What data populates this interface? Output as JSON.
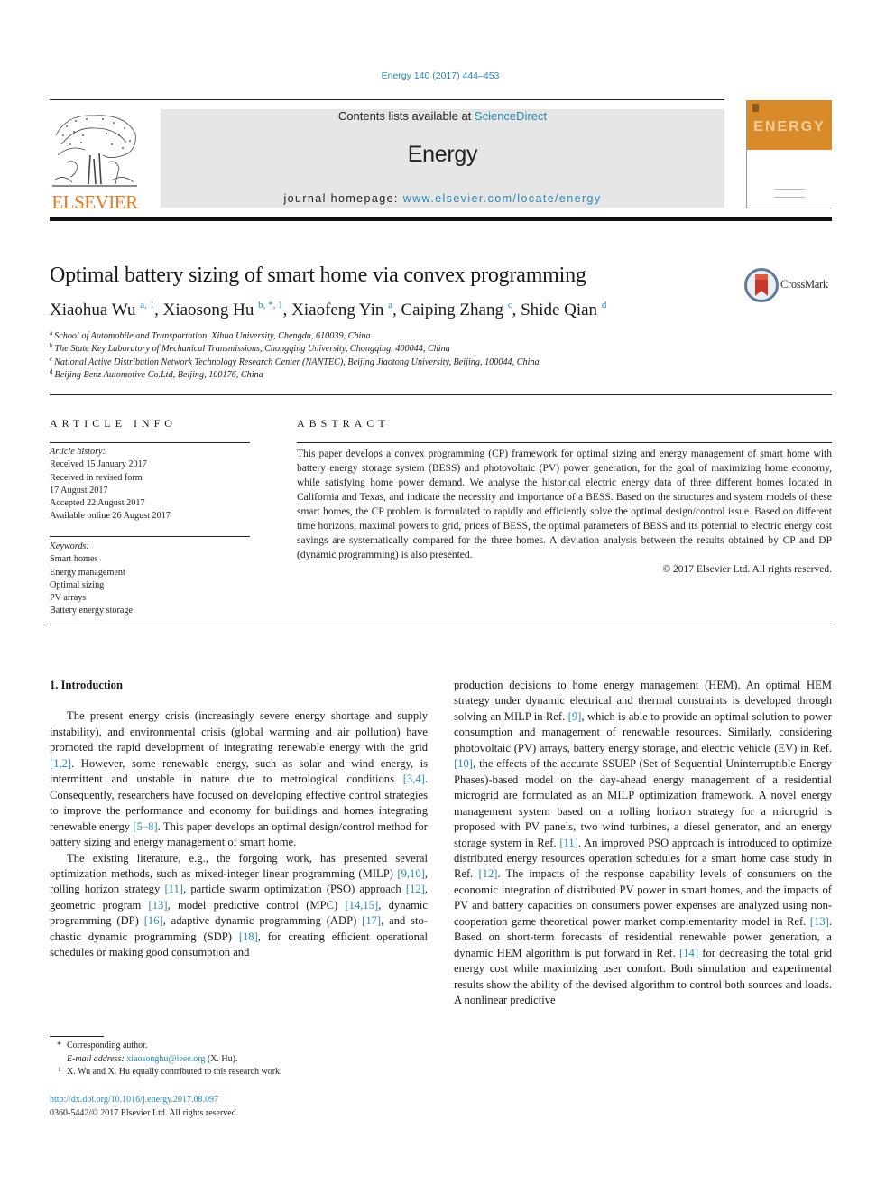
{
  "journal_ref": "Energy 140 (2017) 444–453",
  "publisher": {
    "wordmark": "ELSEVIER",
    "brand_color": "#e87722",
    "link_color": "#2a87b4"
  },
  "masthead": {
    "contents_prefix": "Contents lists available at ",
    "contents_link": "ScienceDirect",
    "journal_name": "Energy",
    "homepage_prefix": "journal homepage: ",
    "homepage_link": "www.elsevier.com/locate/energy"
  },
  "cover": {
    "title": "ENERGY",
    "color": "#d98a2a"
  },
  "article": {
    "title": "Optimal battery sizing of smart home via convex programming",
    "crossmark_label": "CrossMark",
    "authors": [
      {
        "name": "Xiaohua Wu",
        "sup": "a, 1"
      },
      {
        "name": "Xiaosong Hu",
        "sup": "b, *, 1"
      },
      {
        "name": "Xiaofeng Yin",
        "sup": "a"
      },
      {
        "name": "Caiping Zhang",
        "sup": "c"
      },
      {
        "name": "Shide Qian",
        "sup": "d"
      }
    ],
    "affiliations": [
      {
        "mark": "a",
        "text": "School of Automobile and Transportation, Xihua University, Chengdu, 610039, China"
      },
      {
        "mark": "b",
        "text": "The State Key Laboratory of Mechanical Transmissions, Chongqing University, Chongqing, 400044, China"
      },
      {
        "mark": "c",
        "text": "National Active Distribution Network Technology Research Center (NANTEC), Beijing Jiaotong University, Beijing, 100044, China"
      },
      {
        "mark": "d",
        "text": "Beijing Benz Automotive Co.Ltd, Beijing, 100176, China"
      }
    ]
  },
  "article_info": {
    "heading": "ARTICLE INFO",
    "history_label": "Article history:",
    "history": [
      "Received 15 January 2017",
      "Received in revised form",
      "17 August 2017",
      "Accepted 22 August 2017",
      "Available online 26 August 2017"
    ],
    "keywords_label": "Keywords:",
    "keywords": [
      "Smart homes",
      "Energy management",
      "Optimal sizing",
      "PV arrays",
      "Battery energy storage"
    ]
  },
  "abstract": {
    "heading": "ABSTRACT",
    "text": "This paper develops a convex programming (CP) framework for optimal sizing and energy management of smart home with battery energy storage system (BESS) and photovoltaic (PV) power generation, for the goal of maximizing home economy, while satisfying home power demand. We analyse the historical electric energy data of three different homes located in California and Texas, and indicate the necessity and importance of a BESS. Based on the structures and system models of these smart homes, the CP problem is formulated to rapidly and efficiently solve the optimal design/control issue. Based on different time horizons, maximal powers to grid, prices of BESS, the optimal parameters of BESS and its potential to electric energy cost savings are systematically compared for the three homes. A deviation analysis between the results obtained by CP and DP (dynamic programming) is also presented.",
    "copyright": "© 2017 Elsevier Ltd. All rights reserved."
  },
  "body": {
    "section_heading": "1.  Introduction",
    "left_paragraphs": [
      [
        {
          "t": "The present energy crisis (increasingly severe energy shortage and supply instability), and environmental crisis (global warming and air pollution) have promoted the rapid development of inte­grating renewable energy with the grid "
        },
        {
          "c": "[1,2]"
        },
        {
          "t": ". However, some renewable energy, such as solar and wind energy, is intermittent and unstable in nature due to metrological conditions "
        },
        {
          "c": "[3,4]"
        },
        {
          "t": ". Consequently, researchers have focused on developing effective control strategies to improve the performance and economy for buildings and homes integrating renewable energy "
        },
        {
          "c": "[5–8]"
        },
        {
          "t": ". This paper develops an optimal design/control method for battery sizing and energy management of smart home."
        }
      ],
      [
        {
          "t": "The existing literature, e.g., the forgoing work, has presented several optimization methods, such as mixed-integer linear pro­gramming (MILP) "
        },
        {
          "c": "[9,10]"
        },
        {
          "t": ", rolling horizon strategy "
        },
        {
          "c": "[11]"
        },
        {
          "t": ", particle swarm optimization (PSO) approach "
        },
        {
          "c": "[12]"
        },
        {
          "t": ", geometric program "
        },
        {
          "c": "[13]"
        },
        {
          "t": ", model predictive control (MPC) "
        },
        {
          "c": "[14,15]"
        },
        {
          "t": ", dynamic programming (DP) "
        },
        {
          "c": "[16]"
        },
        {
          "t": ", adaptive dynamic programming (ADP) "
        },
        {
          "c": "[17]"
        },
        {
          "t": ", and sto­chastic dynamic programming (SDP) "
        },
        {
          "c": "[18]"
        },
        {
          "t": ", for creating efficient operational schedules or making good consumption and"
        }
      ]
    ],
    "right_paragraph": [
      {
        "t": "production decisions to home energy management (HEM). An optimal HEM strategy under dynamic electrical and thermal con­straints is developed through solving an MILP in Ref. "
      },
      {
        "c": "[9]"
      },
      {
        "t": ", which is able to provide an optimal solution to power consumption and management of renewable resources. Similarly, considering photovoltaic (PV) arrays, battery energy storage, and electric vehicle (EV) in Ref. "
      },
      {
        "c": "[10]"
      },
      {
        "t": ", the effects of the accurate SSUEP (Set of Sequential Uninterruptible Energy Phases)-based model on the day-ahead energy management of a residential microgrid are formulated as an MILP optimization framework. A novel energy management system based on a rolling horizon strategy for a microgrid is proposed with PV panels, two wind turbines, a diesel generator, and an energy storage system in Ref. "
      },
      {
        "c": "[11]"
      },
      {
        "t": ". An improved PSO approach is introduced to optimize distributed energy re­sources operation schedules for a smart home case study in Ref. "
      },
      {
        "c": "[12]"
      },
      {
        "t": ". The impacts of the response capability levels of consumers on the economic integration of distributed PV power in smart homes, and the impacts of PV and battery capacities on consumers power expenses are analyzed using non-cooperation game theo­retical power market complementarity model in Ref. "
      },
      {
        "c": "[13]"
      },
      {
        "t": ". Based on short-term forecasts of residential renewable power generation, a dynamic HEM algorithm is put forward in Ref. "
      },
      {
        "c": "[14]"
      },
      {
        "t": " for decreasing the total grid energy cost while maximizing user comfort. Both simulation and experimental results show the ability of the devised algorithm to control both sources and loads. A nonlinear predictive"
      }
    ]
  },
  "footnotes": {
    "corresponding_mark": "*",
    "corresponding_text": "Corresponding author.",
    "email_label": "E-mail address: ",
    "email": "xiaosonghu@ieee.org",
    "email_suffix": " (X. Hu).",
    "note1_mark": "1",
    "note1_text": "X. Wu and X. Hu equally contributed to this research work."
  },
  "doi": {
    "link": "http://dx.doi.org/10.1016/j.energy.2017.08.097",
    "issn_line": "0360-5442/© 2017 Elsevier Ltd. All rights reserved."
  }
}
